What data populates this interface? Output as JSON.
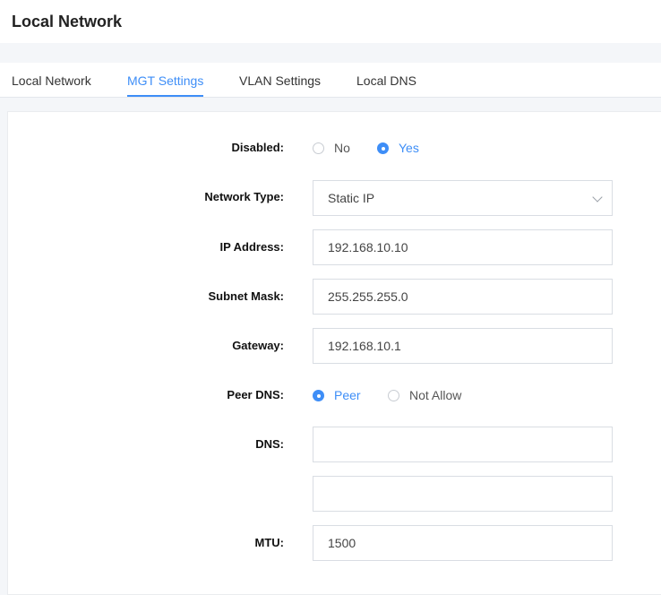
{
  "page": {
    "title": "Local Network"
  },
  "tabs": [
    {
      "label": "Local Network"
    },
    {
      "label": "MGT Settings"
    },
    {
      "label": "VLAN Settings"
    },
    {
      "label": "Local DNS"
    }
  ],
  "active_tab": "MGT Settings",
  "accent_color": "#3e8ef7",
  "form": {
    "disabled": {
      "label": "Disabled:",
      "options": [
        "No",
        "Yes"
      ],
      "selected": "Yes"
    },
    "network_type": {
      "label": "Network Type:",
      "value": "Static IP"
    },
    "ip_address": {
      "label": "IP Address:",
      "value": "192.168.10.10"
    },
    "subnet_mask": {
      "label": "Subnet Mask:",
      "value": "255.255.255.0"
    },
    "gateway": {
      "label": "Gateway:",
      "value": "192.168.10.1"
    },
    "peer_dns": {
      "label": "Peer DNS:",
      "options": [
        "Peer",
        "Not Allow"
      ],
      "selected": "Peer"
    },
    "dns": {
      "label": "DNS:",
      "values": [
        "",
        ""
      ]
    },
    "mtu": {
      "label": "MTU:",
      "value": "1500"
    }
  }
}
